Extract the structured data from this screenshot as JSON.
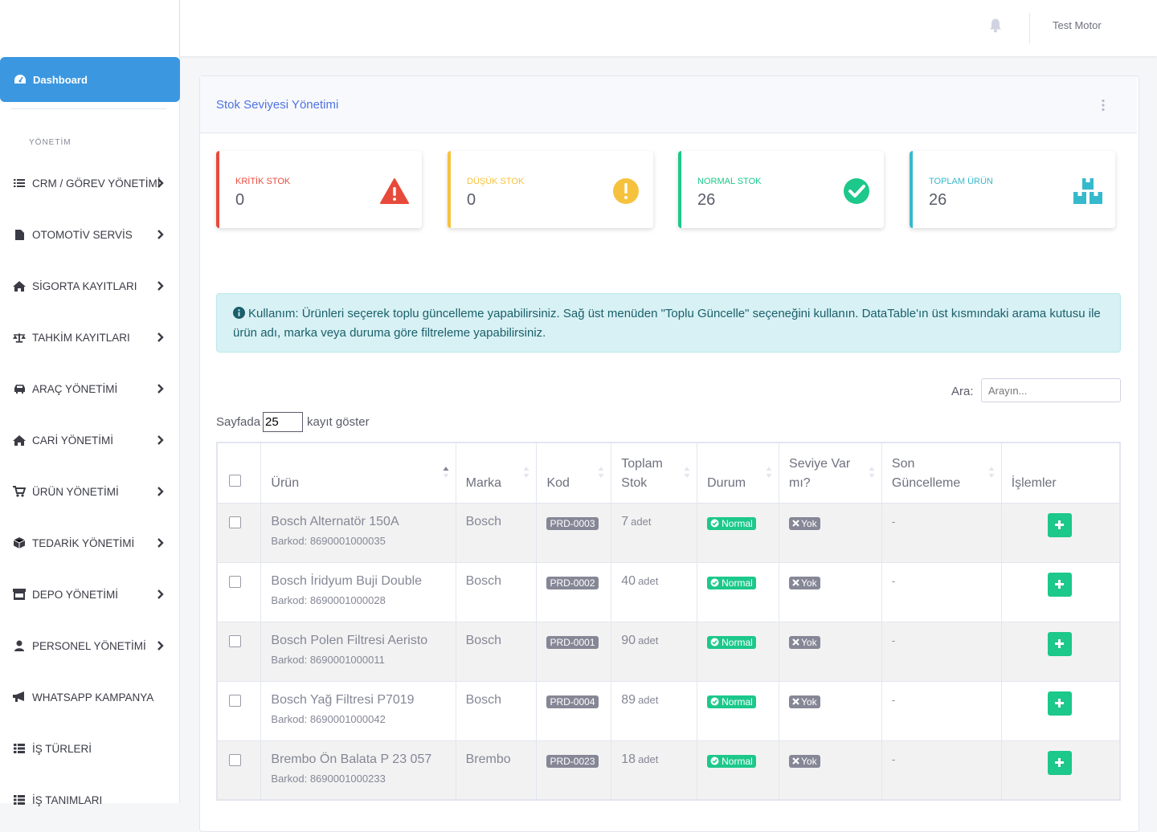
{
  "sidebar": {
    "dashboard": "Dashboard",
    "heading": "YÖNETİM",
    "items": [
      {
        "label": "CRM / GÖREV YÖNETİMİ",
        "icon": "list-icon"
      },
      {
        "label": "OTOMOTİV SERVİS",
        "icon": "file-icon"
      },
      {
        "label": "SİGORTA KAYITLARI",
        "icon": "home-icon"
      },
      {
        "label": "TAHKİM KAYITLARI",
        "icon": "balance-scale-icon"
      },
      {
        "label": "ARAÇ YÖNETİMİ",
        "icon": "car-icon"
      },
      {
        "label": "CARİ YÖNETİMİ",
        "icon": "home-icon"
      },
      {
        "label": "ÜRÜN YÖNETİMİ",
        "icon": "cart-icon"
      },
      {
        "label": "TEDARİK YÖNETİMİ",
        "icon": "box-icon"
      },
      {
        "label": "DEPO YÖNETİMİ",
        "icon": "store-icon"
      },
      {
        "label": "PERSONEL YÖNETİMİ",
        "icon": "user-icon"
      },
      {
        "label": "WHATSAPP KAMPANYA",
        "icon": "bullhorn-icon"
      },
      {
        "label": "İŞ TÜRLERİ",
        "icon": "table-list-icon"
      },
      {
        "label": "İŞ TANIMLARI",
        "icon": "table-list-icon"
      }
    ]
  },
  "topbar": {
    "user": "Test Motor"
  },
  "card": {
    "title": "Stok Seviyesi Yönetimi"
  },
  "stats": [
    {
      "label": "KRİTİK STOK",
      "value": "0",
      "color": "#e74a3b",
      "icon": "warning-triangle-icon"
    },
    {
      "label": "DÜŞÜK STOK",
      "value": "0",
      "color": "#f6c23e",
      "icon": "exclamation-circle-icon"
    },
    {
      "label": "NORMAL STOK",
      "value": "26",
      "color": "#1cc88a",
      "icon": "check-circle-icon"
    },
    {
      "label": "TOPLAM ÜRÜN",
      "value": "26",
      "color": "#36b9cc",
      "icon": "boxes-icon"
    }
  ],
  "info": {
    "text": "Kullanım: Ürünleri seçerek toplu güncelleme yapabilirsiniz. Sağ üst menüden \"Toplu Güncelle\" seçeneğini kullanın. DataTable'ın üst kısmındaki arama kutusu ile ürün adı, marka veya duruma göre filtreleme yapabilirsiniz."
  },
  "search": {
    "label": "Ara:",
    "placeholder": "Arayın..."
  },
  "length": {
    "prefix": "Sayfada",
    "value": "25",
    "suffix": "kayıt göster"
  },
  "table": {
    "headers": [
      "Ürün",
      "Marka",
      "Kod",
      "Toplam Stok",
      "Durum",
      "Seviye Var mı?",
      "Son Güncelleme",
      "İşlemler"
    ],
    "rows": [
      {
        "name": "Bosch Alternatör 150A",
        "barkod": "Barkod: 8690001000035",
        "brand": "Bosch",
        "code": "PRD-0003",
        "stock": "7",
        "unit": "adet",
        "status": "Normal",
        "level": "Yok",
        "updated": "-"
      },
      {
        "name": "Bosch İridyum Buji Double",
        "barkod": "Barkod: 8690001000028",
        "brand": "Bosch",
        "code": "PRD-0002",
        "stock": "40",
        "unit": "adet",
        "status": "Normal",
        "level": "Yok",
        "updated": "-"
      },
      {
        "name": "Bosch Polen Filtresi Aeristo",
        "barkod": "Barkod: 8690001000011",
        "brand": "Bosch",
        "code": "PRD-0001",
        "stock": "90",
        "unit": "adet",
        "status": "Normal",
        "level": "Yok",
        "updated": "-"
      },
      {
        "name": "Bosch Yağ Filtresi P7019",
        "barkod": "Barkod: 8690001000042",
        "brand": "Bosch",
        "code": "PRD-0004",
        "stock": "89",
        "unit": "adet",
        "status": "Normal",
        "level": "Yok",
        "updated": "-"
      },
      {
        "name": "Brembo Ön Balata P 23 057",
        "barkod": "Barkod: 8690001000233",
        "brand": "Brembo",
        "code": "PRD-0023",
        "stock": "18",
        "unit": "adet",
        "status": "Normal",
        "level": "Yok",
        "updated": "-"
      }
    ]
  }
}
